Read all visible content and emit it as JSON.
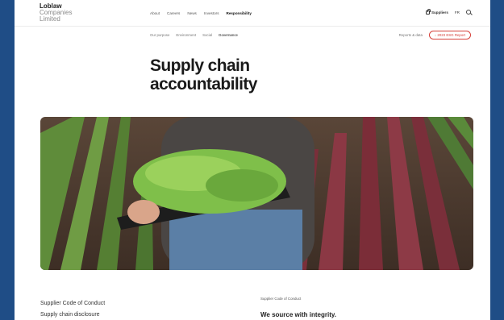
{
  "logo": {
    "line1": "Loblaw",
    "line2": "Companies",
    "line3": "Limited"
  },
  "main_nav": [
    {
      "label": "About"
    },
    {
      "label": "Careers"
    },
    {
      "label": "News"
    },
    {
      "label": "Investors"
    },
    {
      "label": "Responsibility",
      "active": true
    }
  ],
  "utility": {
    "suppliers": "Suppliers",
    "language": "FR"
  },
  "sub_nav": [
    {
      "label": "Our purpose"
    },
    {
      "label": "Environment"
    },
    {
      "label": "Social"
    },
    {
      "label": "Governance",
      "active": true
    }
  ],
  "sub_right": {
    "reports": "Reports & data",
    "esg_button": "↓ 2023 ESG Report"
  },
  "page": {
    "title_line1": "Supply chain",
    "title_line2": "accountability"
  },
  "hero": {
    "image_desc": "farm-seedlings-tray"
  },
  "sections": {
    "links": [
      "Supplier Code of Conduct",
      "Supply chain disclosure"
    ],
    "small_label": "Supplier Code of Conduct",
    "tagline": "We source with integrity."
  },
  "colors": {
    "frame_bg": "#1f4d86",
    "accent_red": "#d6403a"
  }
}
